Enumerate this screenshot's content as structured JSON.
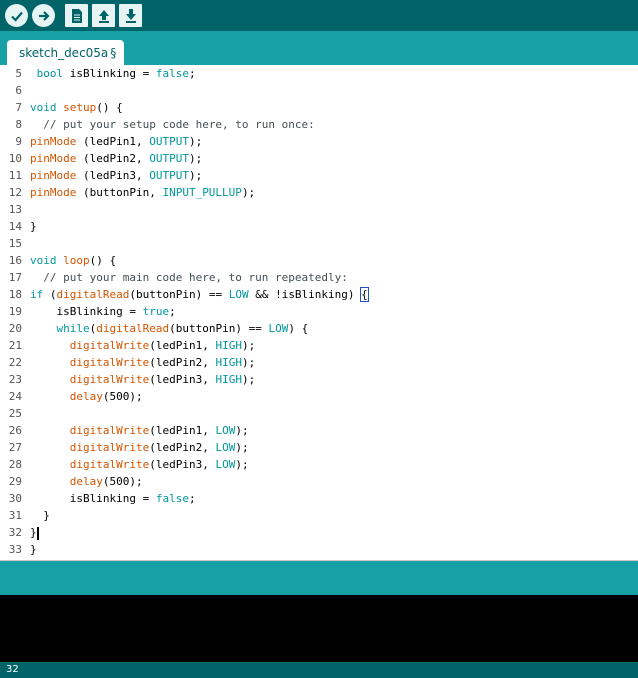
{
  "toolbar": {
    "buttons": [
      {
        "name": "verify",
        "icon": "checkmark-icon"
      },
      {
        "name": "upload",
        "icon": "arrow-right-icon"
      },
      {
        "name": "new",
        "icon": "new-file-icon"
      },
      {
        "name": "open",
        "icon": "open-arrow-up-icon"
      },
      {
        "name": "save",
        "icon": "save-arrow-down-icon"
      }
    ]
  },
  "tab": {
    "label": "sketch_dec05a",
    "mark": "§"
  },
  "editor": {
    "lines": [
      {
        "n": "5",
        "text": " bool isBlinking = false;"
      },
      {
        "n": "6",
        "text": ""
      },
      {
        "n": "7",
        "text": "void setup() {"
      },
      {
        "n": "8",
        "text": "  // put your setup code here, to run once:"
      },
      {
        "n": "9",
        "text": "pinMode (ledPin1, OUTPUT);"
      },
      {
        "n": "10",
        "text": "pinMode (ledPin2, OUTPUT);"
      },
      {
        "n": "11",
        "text": "pinMode (ledPin3, OUTPUT);"
      },
      {
        "n": "12",
        "text": "pinMode (buttonPin, INPUT_PULLUP);"
      },
      {
        "n": "13",
        "text": ""
      },
      {
        "n": "14",
        "text": "}"
      },
      {
        "n": "15",
        "text": ""
      },
      {
        "n": "16",
        "text": "void loop() {"
      },
      {
        "n": "17",
        "text": "  // put your main code here, to run repeatedly:"
      },
      {
        "n": "18",
        "text": "if (digitalRead(buttonPin) == LOW && !isBlinking) {"
      },
      {
        "n": "19",
        "text": "    isBlinking = true;"
      },
      {
        "n": "20",
        "text": "    while(digitalRead(buttonPin) == LOW) {"
      },
      {
        "n": "21",
        "text": "      digitalWrite(ledPin1, HIGH);"
      },
      {
        "n": "22",
        "text": "      digitalWrite(ledPin2, HIGH);"
      },
      {
        "n": "23",
        "text": "      digitalWrite(ledPin3, HIGH);"
      },
      {
        "n": "24",
        "text": "      delay(500);"
      },
      {
        "n": "25",
        "text": ""
      },
      {
        "n": "26",
        "text": "      digitalWrite(ledPin1, LOW);"
      },
      {
        "n": "27",
        "text": "      digitalWrite(ledPin2, LOW);"
      },
      {
        "n": "28",
        "text": "      digitalWrite(ledPin3, LOW);"
      },
      {
        "n": "29",
        "text": "      delay(500);"
      },
      {
        "n": "30",
        "text": "      isBlinking = false;"
      },
      {
        "n": "31",
        "text": "  }"
      },
      {
        "n": "32",
        "text": "}"
      },
      {
        "n": "33",
        "text": "}"
      }
    ]
  },
  "status": {
    "line_number": "32"
  },
  "colors": {
    "toolbar": "#006468",
    "tabstrip": "#17a1a5",
    "keyword": "#00979c",
    "function": "#d35400",
    "comment": "#434f54"
  }
}
